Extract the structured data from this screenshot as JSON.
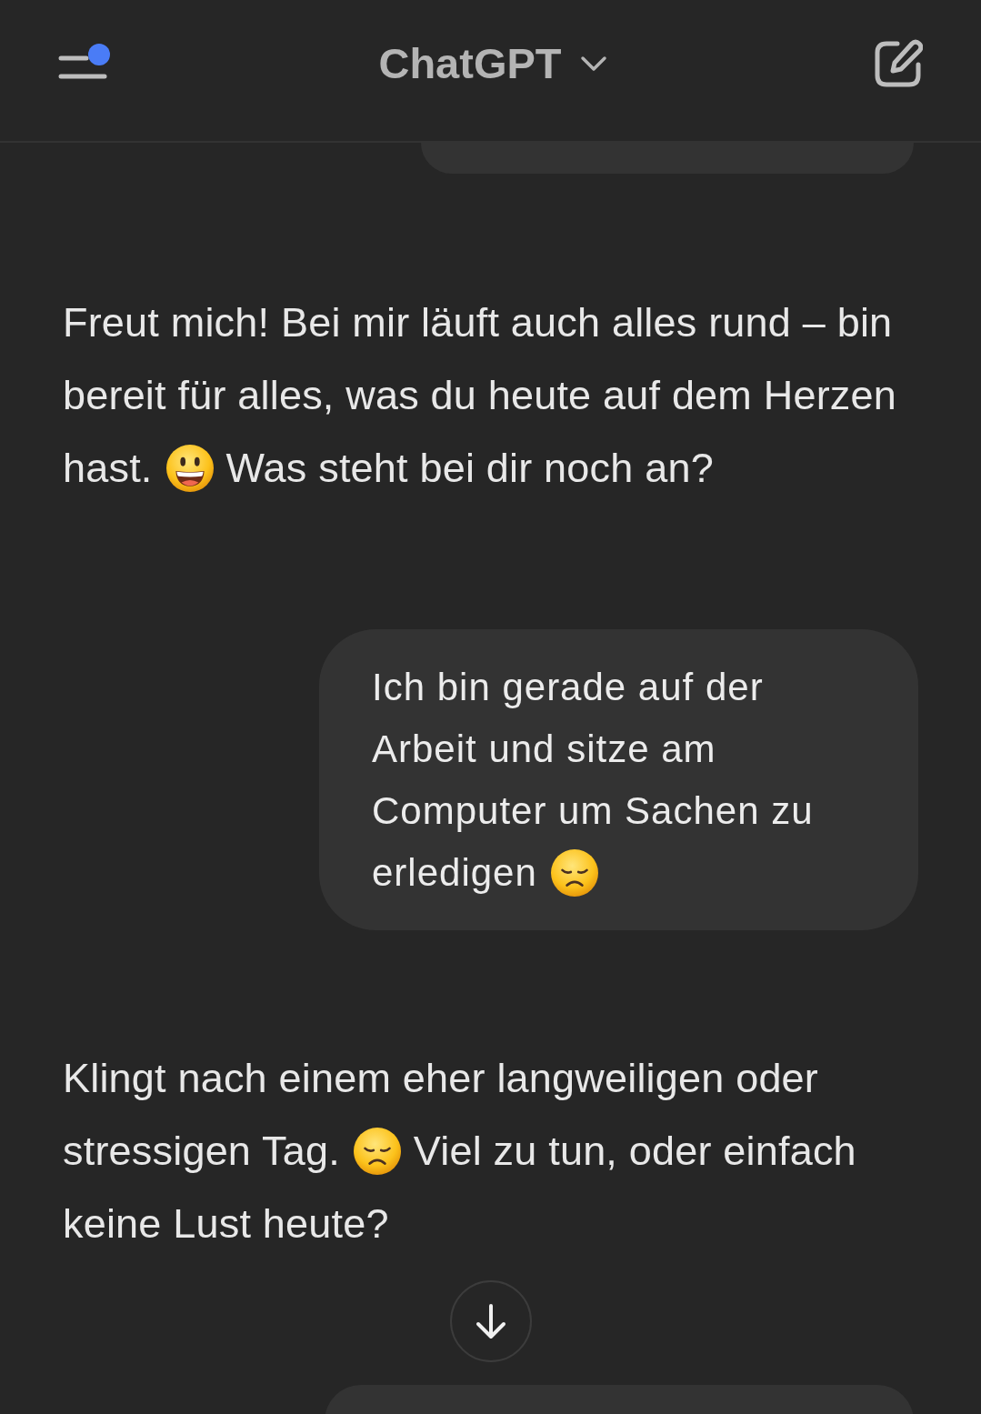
{
  "header": {
    "title": "ChatGPT",
    "menu_unread_dot": true
  },
  "messages": [
    {
      "kind": "partial"
    },
    {
      "kind": "assistant",
      "lines": [
        [
          {
            "kind": "text",
            "text": "Freut mich! Bei mir läuft auch alles rund – bin"
          }
        ],
        [
          {
            "kind": "text",
            "text": "bereit für alles, was du heute auf dem Herzen"
          }
        ],
        [
          {
            "kind": "text",
            "text": "hast."
          },
          {
            "kind": "grin"
          },
          {
            "kind": "text",
            "text": "Was steht bei dir noch an?"
          }
        ]
      ]
    },
    {
      "kind": "user",
      "lines": [
        [
          {
            "kind": "text",
            "text": "Ich bin gerade auf der"
          }
        ],
        [
          {
            "kind": "text",
            "text": "Arbeit und sitze am"
          }
        ],
        [
          {
            "kind": "text",
            "text": "Computer um Sachen zu"
          }
        ],
        [
          {
            "kind": "text",
            "text": "erledigen"
          },
          {
            "kind": "sad"
          }
        ]
      ]
    },
    {
      "kind": "assistant",
      "lines": [
        [
          {
            "kind": "text",
            "text": "Klingt nach einem eher langweiligen oder"
          }
        ],
        [
          {
            "kind": "text",
            "text": "stressigen Tag."
          },
          {
            "kind": "sad"
          },
          {
            "kind": "text",
            "text": "Viel zu tun, oder einfach"
          }
        ],
        [
          {
            "kind": "text",
            "text": "keine Lust heute?"
          }
        ]
      ]
    },
    {
      "kind": "partial"
    }
  ],
  "scroll_down_button": true
}
